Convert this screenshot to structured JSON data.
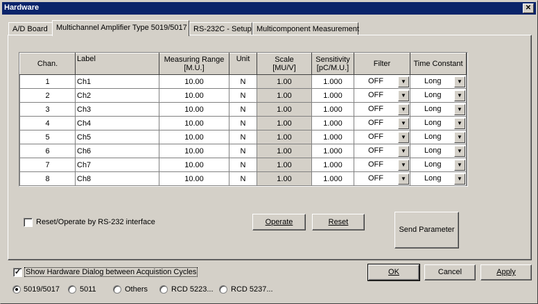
{
  "window": {
    "title": "Hardware",
    "close_label": "✕"
  },
  "tabs": [
    {
      "label": "A/D Board"
    },
    {
      "label": "Multichannel Amplifier Type 5019/5017"
    },
    {
      "label": "RS-232C - Setup"
    },
    {
      "label": "Multicomponent Measurement"
    }
  ],
  "table": {
    "headers": {
      "chan": "Chan.",
      "label": "Label",
      "range": [
        "Measuring Range",
        "[M.U.]"
      ],
      "unit": "Unit",
      "scale": [
        "Scale",
        "[MU/V]"
      ],
      "sensitivity": [
        "Sensitivity",
        "[pC/M.U.]"
      ],
      "filter": "Filter",
      "time_constant": "Time Constant"
    },
    "rows": [
      {
        "chan": "1",
        "label": "Ch1",
        "range": "10.00",
        "unit": "N",
        "scale": "1.00",
        "sensitivity": "1.000",
        "filter": "OFF",
        "tc": "Long"
      },
      {
        "chan": "2",
        "label": "Ch2",
        "range": "10.00",
        "unit": "N",
        "scale": "1.00",
        "sensitivity": "1.000",
        "filter": "OFF",
        "tc": "Long"
      },
      {
        "chan": "3",
        "label": "Ch3",
        "range": "10.00",
        "unit": "N",
        "scale": "1.00",
        "sensitivity": "1.000",
        "filter": "OFF",
        "tc": "Long"
      },
      {
        "chan": "4",
        "label": "Ch4",
        "range": "10.00",
        "unit": "N",
        "scale": "1.00",
        "sensitivity": "1.000",
        "filter": "OFF",
        "tc": "Long"
      },
      {
        "chan": "5",
        "label": "Ch5",
        "range": "10.00",
        "unit": "N",
        "scale": "1.00",
        "sensitivity": "1.000",
        "filter": "OFF",
        "tc": "Long"
      },
      {
        "chan": "6",
        "label": "Ch6",
        "range": "10.00",
        "unit": "N",
        "scale": "1.00",
        "sensitivity": "1.000",
        "filter": "OFF",
        "tc": "Long"
      },
      {
        "chan": "7",
        "label": "Ch7",
        "range": "10.00",
        "unit": "N",
        "scale": "1.00",
        "sensitivity": "1.000",
        "filter": "OFF",
        "tc": "Long"
      },
      {
        "chan": "8",
        "label": "Ch8",
        "range": "10.00",
        "unit": "N",
        "scale": "1.00",
        "sensitivity": "1.000",
        "filter": "OFF",
        "tc": "Long"
      }
    ]
  },
  "controls": {
    "reset_operate_label": "Reset/Operate by RS-232 interface",
    "reset_operate_checked": false,
    "operate_button": "Operate",
    "reset_button": "Reset",
    "send_parameter_button": "Send Parameter"
  },
  "footer": {
    "show_dialog_label": "Show Hardware Dialog between Acquistion Cycles",
    "show_dialog_checked": true,
    "ok_button": "OK",
    "cancel_button": "Cancel",
    "apply_button": "Apply",
    "radios": [
      {
        "label": "5019/5017",
        "selected": true
      },
      {
        "label": "5011",
        "selected": false
      },
      {
        "label": "Others",
        "selected": false
      },
      {
        "label": "RCD 5223...",
        "selected": false
      },
      {
        "label": "RCD 5237...",
        "selected": false
      }
    ]
  },
  "icons": {
    "dropdown": "chevron-down-icon",
    "check": "checkmark-icon"
  }
}
